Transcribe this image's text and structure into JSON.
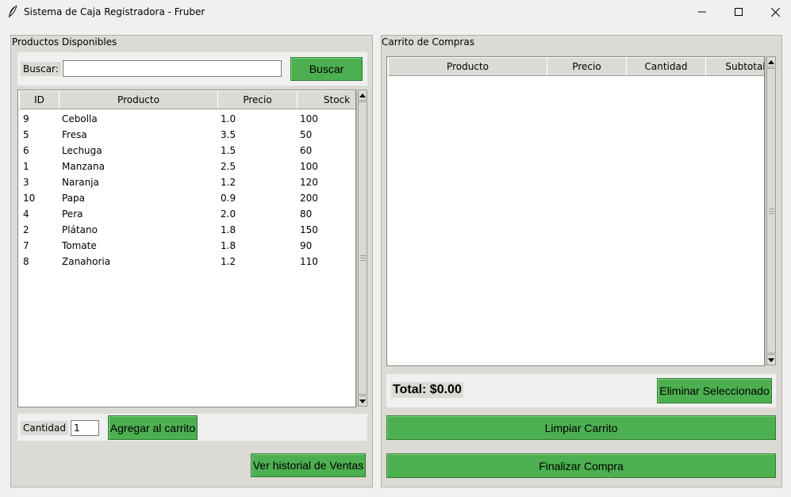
{
  "window": {
    "title": "Sistema de Caja Registradora - Fruber",
    "minimize_glyph": "—",
    "maximize_glyph": "☐",
    "close_glyph": "✕"
  },
  "products": {
    "frame_label": "Productos Disponibles",
    "search_label": "Buscar:",
    "search_value": "",
    "search_button": "Buscar",
    "columns": [
      "ID",
      "Producto",
      "Precio",
      "Stock"
    ],
    "rows": [
      [
        "9",
        "Cebolla",
        "1.0",
        "100"
      ],
      [
        "5",
        "Fresa",
        "3.5",
        "50"
      ],
      [
        "6",
        "Lechuga",
        "1.5",
        "60"
      ],
      [
        "1",
        "Manzana",
        "2.5",
        "100"
      ],
      [
        "3",
        "Naranja",
        "1.2",
        "120"
      ],
      [
        "10",
        "Papa",
        "0.9",
        "200"
      ],
      [
        "4",
        "Pera",
        "2.0",
        "80"
      ],
      [
        "2",
        "Plátano",
        "1.8",
        "150"
      ],
      [
        "7",
        "Tomate",
        "1.8",
        "90"
      ],
      [
        "8",
        "Zanahoria",
        "1.2",
        "110"
      ]
    ],
    "quantity_label": "Cantidad",
    "quantity_value": "1",
    "add_button": "Agregar al carrito",
    "history_button": "Ver historial de Ventas"
  },
  "cart": {
    "frame_label": "Carrito de Compras",
    "columns": [
      "Producto",
      "Precio",
      "Cantidad",
      "Subtotal"
    ],
    "total_text": "Total: $0.00",
    "delete_button": "Eliminar Seleccionado",
    "clear_button": "Limpiar Carrito",
    "checkout_button": "Finalizar Compra"
  },
  "colors": {
    "button_green": "#4caf50",
    "frame_bg": "#dcdad5",
    "window_bg": "#f0f0f0"
  }
}
